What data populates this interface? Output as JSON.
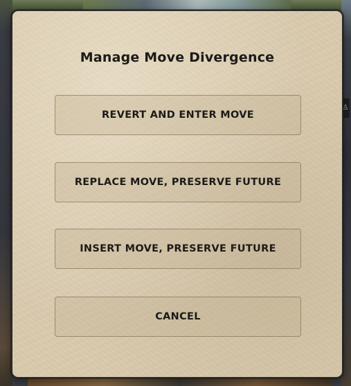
{
  "dialog": {
    "title": "Manage Move Divergence",
    "options": [
      {
        "label": "REVERT AND ENTER MOVE"
      },
      {
        "label": "REPLACE MOVE, PRESERVE FUTURE"
      },
      {
        "label": "INSERT MOVE, PRESERVE FUTURE"
      },
      {
        "label": "CANCEL"
      }
    ]
  },
  "colors": {
    "panel_background": "#d8c9ad",
    "panel_border": "#2b2a28",
    "text": "#1b1a17"
  },
  "background": {
    "side_icon": "figure-icon"
  }
}
